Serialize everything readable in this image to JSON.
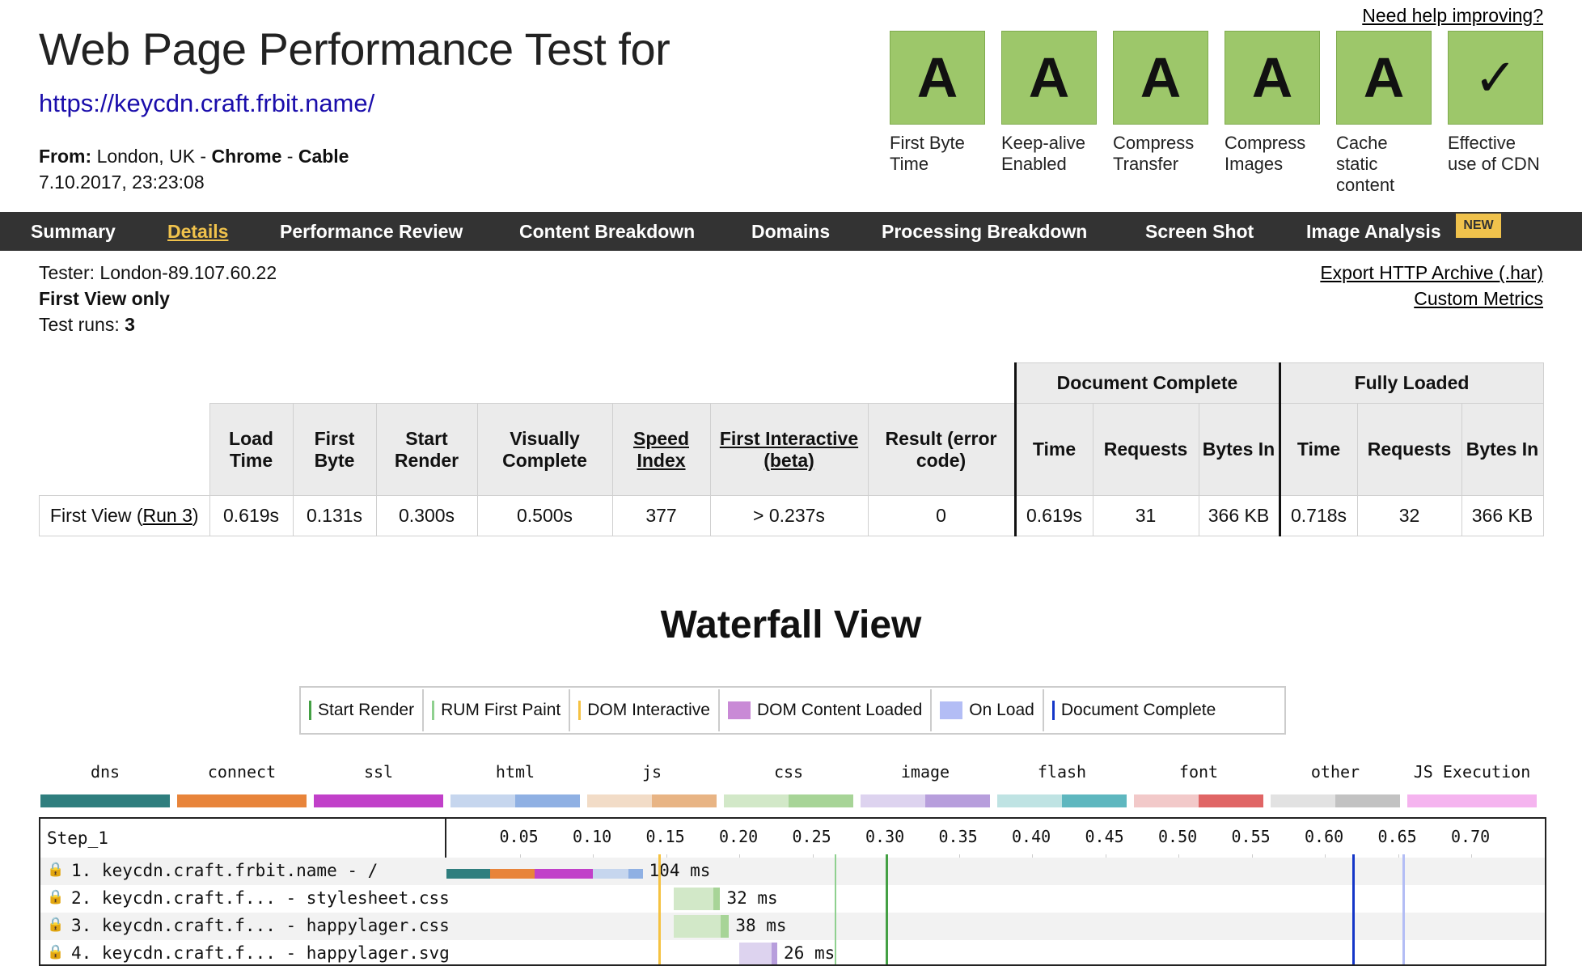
{
  "header": {
    "title": "Web Page Performance Test for",
    "url": "https://keycdn.craft.frbit.name/",
    "from_label": "From:",
    "from_location": "London, UK -",
    "from_browser": "Chrome",
    "from_sep": "-",
    "from_connection": "Cable",
    "date": "7.10.2017, 23:23:08",
    "help_link": "Need help improving?"
  },
  "grades": [
    {
      "grade": "A",
      "label": "First Byte Time"
    },
    {
      "grade": "A",
      "label": "Keep-alive Enabled"
    },
    {
      "grade": "A",
      "label": "Compress Transfer"
    },
    {
      "grade": "A",
      "label": "Compress Images"
    },
    {
      "grade": "A",
      "label": "Cache static content"
    },
    {
      "grade": "✓",
      "label": "Effective use of CDN"
    }
  ],
  "nav": {
    "items": [
      "Summary",
      "Details",
      "Performance Review",
      "Content Breakdown",
      "Domains",
      "Processing Breakdown",
      "Screen Shot",
      "Image Analysis"
    ],
    "active": "Details",
    "new_badge": "NEW"
  },
  "info": {
    "tester": "Tester: London-89.107.60.22",
    "view": "First View only",
    "runs_label": "Test runs:",
    "runs_value": "3",
    "export_link": "Export HTTP Archive (.har)",
    "custom_metrics_link": "Custom Metrics"
  },
  "results": {
    "group_doc": "Document Complete",
    "group_full": "Fully Loaded",
    "headers": {
      "load_time": "Load Time",
      "first_byte": "First Byte",
      "start_render": "Start Render",
      "visually_complete": "Visually Complete",
      "speed_index": "Speed Index",
      "first_interactive": "First Interactive (beta)",
      "result": "Result (error code)",
      "time": "Time",
      "requests": "Requests",
      "bytes_in": "Bytes In"
    },
    "row_label": "First View (",
    "row_link": "Run 3",
    "row_label_end": ")",
    "values": {
      "load_time": "0.619s",
      "first_byte": "0.131s",
      "start_render": "0.300s",
      "visually_complete": "0.500s",
      "speed_index": "377",
      "first_interactive": "> 0.237s",
      "result": "0",
      "doc_time": "0.619s",
      "doc_requests": "31",
      "doc_bytes": "366 KB",
      "full_time": "0.718s",
      "full_requests": "32",
      "full_bytes": "366 KB"
    }
  },
  "waterfall": {
    "title": "Waterfall View",
    "legend": [
      {
        "label": "Start Render",
        "color": "#44a044",
        "kind": "line"
      },
      {
        "label": "RUM First Paint",
        "color": "#8fd08f",
        "kind": "line"
      },
      {
        "label": "DOM Interactive",
        "color": "#f5c242",
        "kind": "line"
      },
      {
        "label": "DOM Content Loaded",
        "color": "#c98ad6",
        "kind": "box"
      },
      {
        "label": "On Load",
        "color": "#b3bdf5",
        "kind": "box"
      },
      {
        "label": "Document Complete",
        "color": "#1436c8",
        "kind": "line"
      }
    ],
    "types": [
      {
        "label": "dns",
        "c1": "#2f7e7e",
        "c2": "#2f7e7e"
      },
      {
        "label": "connect",
        "c1": "#e8843a",
        "c2": "#e8843a"
      },
      {
        "label": "ssl",
        "c1": "#c140c9",
        "c2": "#c140c9"
      },
      {
        "label": "html",
        "c1": "#c6d6ee",
        "c2": "#8fb0e3"
      },
      {
        "label": "js",
        "c1": "#f2dcc7",
        "c2": "#e8b484"
      },
      {
        "label": "css",
        "c1": "#d2e8c8",
        "c2": "#a7d497"
      },
      {
        "label": "image",
        "c1": "#ddd3ef",
        "c2": "#b79edc"
      },
      {
        "label": "flash",
        "c1": "#bfe3e3",
        "c2": "#5eb7bf"
      },
      {
        "label": "font",
        "c1": "#f2c9c9",
        "c2": "#e06565"
      },
      {
        "label": "other",
        "c1": "#e2e2e2",
        "c2": "#c2c2c2"
      },
      {
        "label": "JS Execution",
        "c1": "#f5b4ef",
        "c2": "#f5b4ef"
      }
    ],
    "step": "Step_1",
    "scale": [
      "0.05",
      "0.10",
      "0.15",
      "0.20",
      "0.25",
      "0.30",
      "0.35",
      "0.40",
      "0.45",
      "0.50",
      "0.55",
      "0.60",
      "0.65",
      "0.70"
    ],
    "requests": [
      {
        "label": "1. keycdn.craft.frbit.name - /",
        "duration": "104 ms",
        "start": 0.0,
        "dns": 0.03,
        "connect": 0.03,
        "ssl": 0.04,
        "wait": 0.07,
        "end": 0.134,
        "type": "html"
      },
      {
        "label": "2. keycdn.craft.f... - stylesheet.css",
        "duration": "32 ms",
        "start": 0.155,
        "wait": 0.155,
        "end": 0.187,
        "type": "css"
      },
      {
        "label": "3. keycdn.craft.f... - happylager.css",
        "duration": "38 ms",
        "start": 0.155,
        "wait": 0.155,
        "end": 0.193,
        "type": "css"
      },
      {
        "label": "4. keycdn.craft.f... - happylager.svg",
        "duration": "26 ms",
        "start": 0.2,
        "wait": 0.2,
        "end": 0.226,
        "type": "image"
      }
    ],
    "markers": {
      "start_render": 0.3,
      "rum_first_paint": 0.265,
      "dom_interactive": 0.145,
      "on_load": 0.653,
      "document_complete": 0.619
    }
  }
}
